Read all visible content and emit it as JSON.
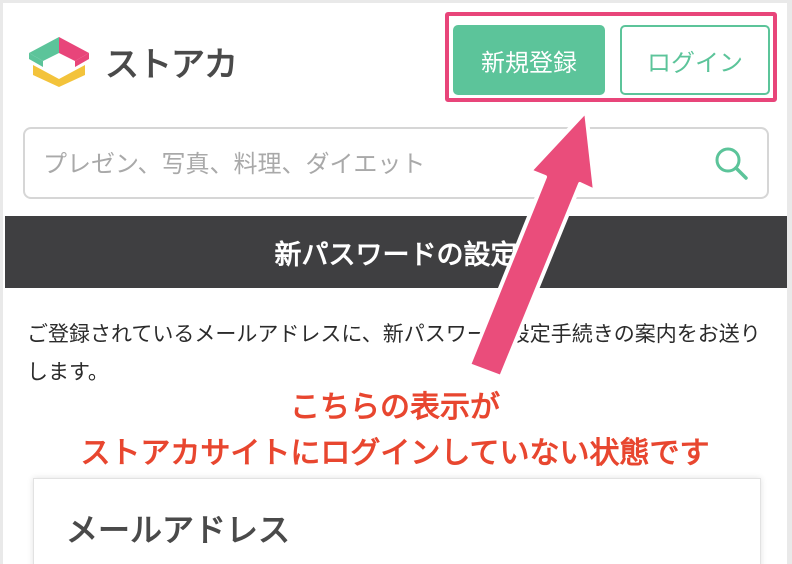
{
  "header": {
    "logo_text": "ストアカ",
    "register_label": "新規登録",
    "login_label": "ログイン"
  },
  "search": {
    "placeholder": "プレゼン、写真、料理、ダイエット",
    "icon": "search-icon"
  },
  "section": {
    "title": "新パスワードの設定"
  },
  "description": "ご登録されているメールアドレスに、新パスワード設定手続きの案内をお送りします。",
  "annotation": {
    "line1": "こちらの表示が",
    "line2": "ストアカサイトにログインしていない状態です"
  },
  "form": {
    "email_label": "メールアドレス"
  },
  "colors": {
    "brand_green": "#5cc49a",
    "highlight_pink": "#e8457a",
    "annotation_red": "#e8462f",
    "section_bar": "#3f3f41"
  }
}
